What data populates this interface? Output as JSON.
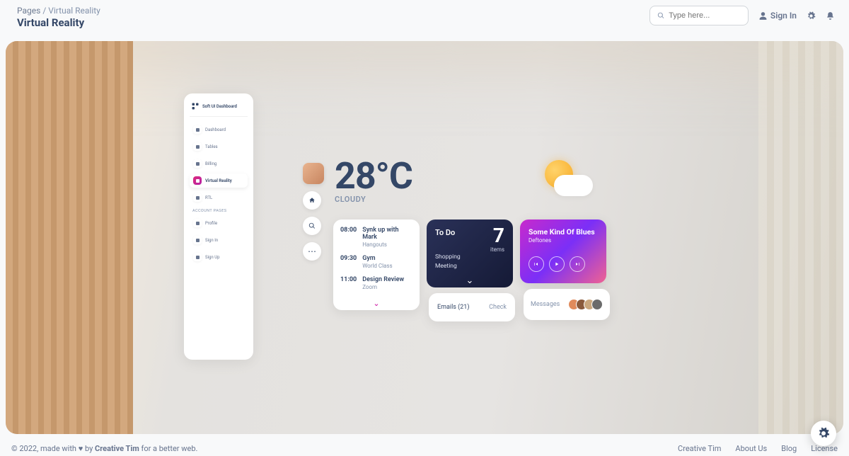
{
  "breadcrumb": {
    "root": "Pages",
    "sep": "/",
    "current": "Virtual Reality"
  },
  "page_title": "Virtual Reality",
  "search": {
    "placeholder": "Type here..."
  },
  "top_nav": {
    "sign_in": "Sign In"
  },
  "sidebar": {
    "brand": "Soft UI Dashboard",
    "items": [
      {
        "label": "Dashboard"
      },
      {
        "label": "Tables"
      },
      {
        "label": "Billing"
      },
      {
        "label": "Virtual Reality",
        "active": true
      },
      {
        "label": "RTL"
      }
    ],
    "account_header": "ACCOUNT PAGES",
    "account_items": [
      {
        "label": "Profile"
      },
      {
        "label": "Sign In"
      },
      {
        "label": "Sign Up"
      }
    ]
  },
  "weather": {
    "temperature": "28°C",
    "status": "CLOUDY"
  },
  "schedule": {
    "items": [
      {
        "time": "08:00",
        "title": "Synk up with Mark",
        "sub": "Hangouts"
      },
      {
        "time": "09:30",
        "title": "Gym",
        "sub": "World Class"
      },
      {
        "time": "11:00",
        "title": "Design Review",
        "sub": "Zoom"
      }
    ]
  },
  "todo": {
    "title": "To Do",
    "count": "7",
    "count_label": "items",
    "list": [
      "Shopping",
      "Meeting"
    ]
  },
  "emails": {
    "label": "Emails (21)",
    "action": "Check"
  },
  "music": {
    "title": "Some Kind Of Blues",
    "artist": "Deftones"
  },
  "messages": {
    "label": "Messages"
  },
  "footer": {
    "left_prefix": "© 2022, made with ",
    "left_mid": " by ",
    "left_author": "Creative Tim",
    "left_suffix": " for a better web.",
    "links": [
      "Creative Tim",
      "About Us",
      "Blog",
      "License"
    ]
  }
}
